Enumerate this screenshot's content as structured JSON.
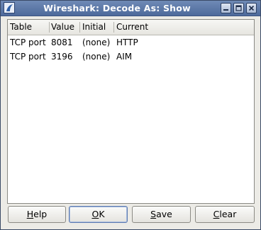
{
  "window": {
    "title": "Wireshark: Decode As: Show"
  },
  "table": {
    "headers": [
      "Table",
      "Value",
      "Initial",
      "Current"
    ],
    "rows": [
      {
        "table": "TCP port",
        "value": "8081",
        "initial": "(none)",
        "current": "HTTP"
      },
      {
        "table": "TCP port",
        "value": "3196",
        "initial": "(none)",
        "current": "AIM"
      }
    ]
  },
  "buttons": {
    "help": {
      "mnemonic": "H",
      "rest": "elp"
    },
    "ok": {
      "mnemonic": "O",
      "rest": "K"
    },
    "save": {
      "mnemonic": "S",
      "rest": "ave"
    },
    "clear": {
      "mnemonic": "C",
      "rest": "lear"
    }
  },
  "icons": {
    "app": "wireshark-fin-icon",
    "minimize": "minimize-icon",
    "maximize": "maximize-icon",
    "close": "close-icon"
  }
}
